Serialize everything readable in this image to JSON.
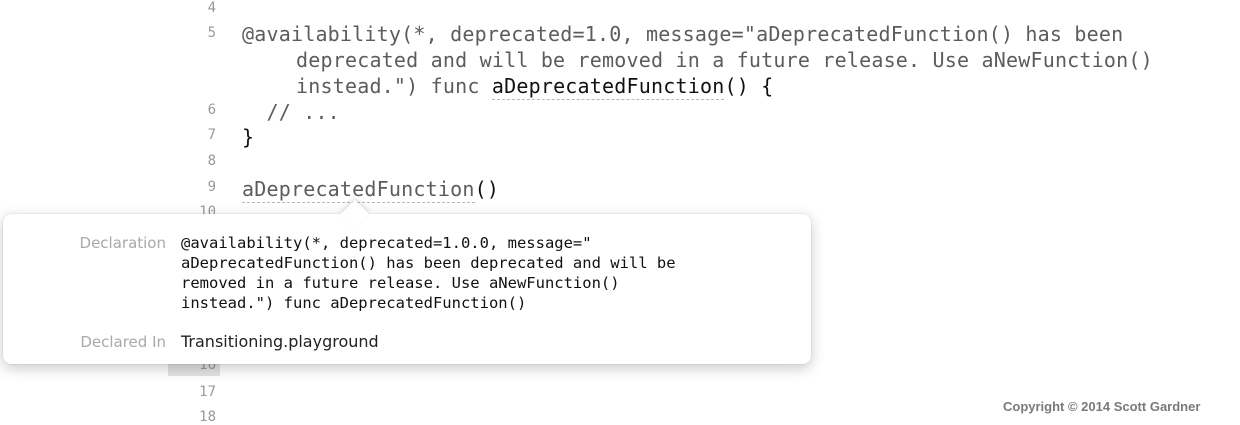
{
  "editor": {
    "line_numbers": {
      "l4": "4",
      "l5": "5",
      "l6": "6",
      "l7": "7",
      "l8": "8",
      "l9": "9",
      "l10": "10",
      "l16": "16",
      "l17": "17",
      "l18": "18"
    },
    "code": {
      "line5_a": "@availability(*, deprecated=1.0, message=\"aDeprecatedFunction() has been",
      "line5_b": "deprecated and will be removed in a future release. Use aNewFunction()",
      "line5_c_pre": "instead.\") func ",
      "line5_c_name": "aDeprecatedFunction",
      "line5_c_post": "() {",
      "line6": "  // ...",
      "line7": "}",
      "line9_name": "aDeprecatedFunction",
      "line9_post": "()"
    }
  },
  "quick_help": {
    "declaration_label": "Declaration",
    "declaration_text": "@availability(*, deprecated=1.0.0, message=\"\naDeprecatedFunction() has been deprecated and will be\nremoved in a future release. Use aNewFunction()\ninstead.\") func aDeprecatedFunction()",
    "declared_in_label": "Declared In",
    "declared_in_value": "Transitioning.playground"
  },
  "footer": {
    "copyright": "Copyright © 2014 Scott Gardner"
  }
}
